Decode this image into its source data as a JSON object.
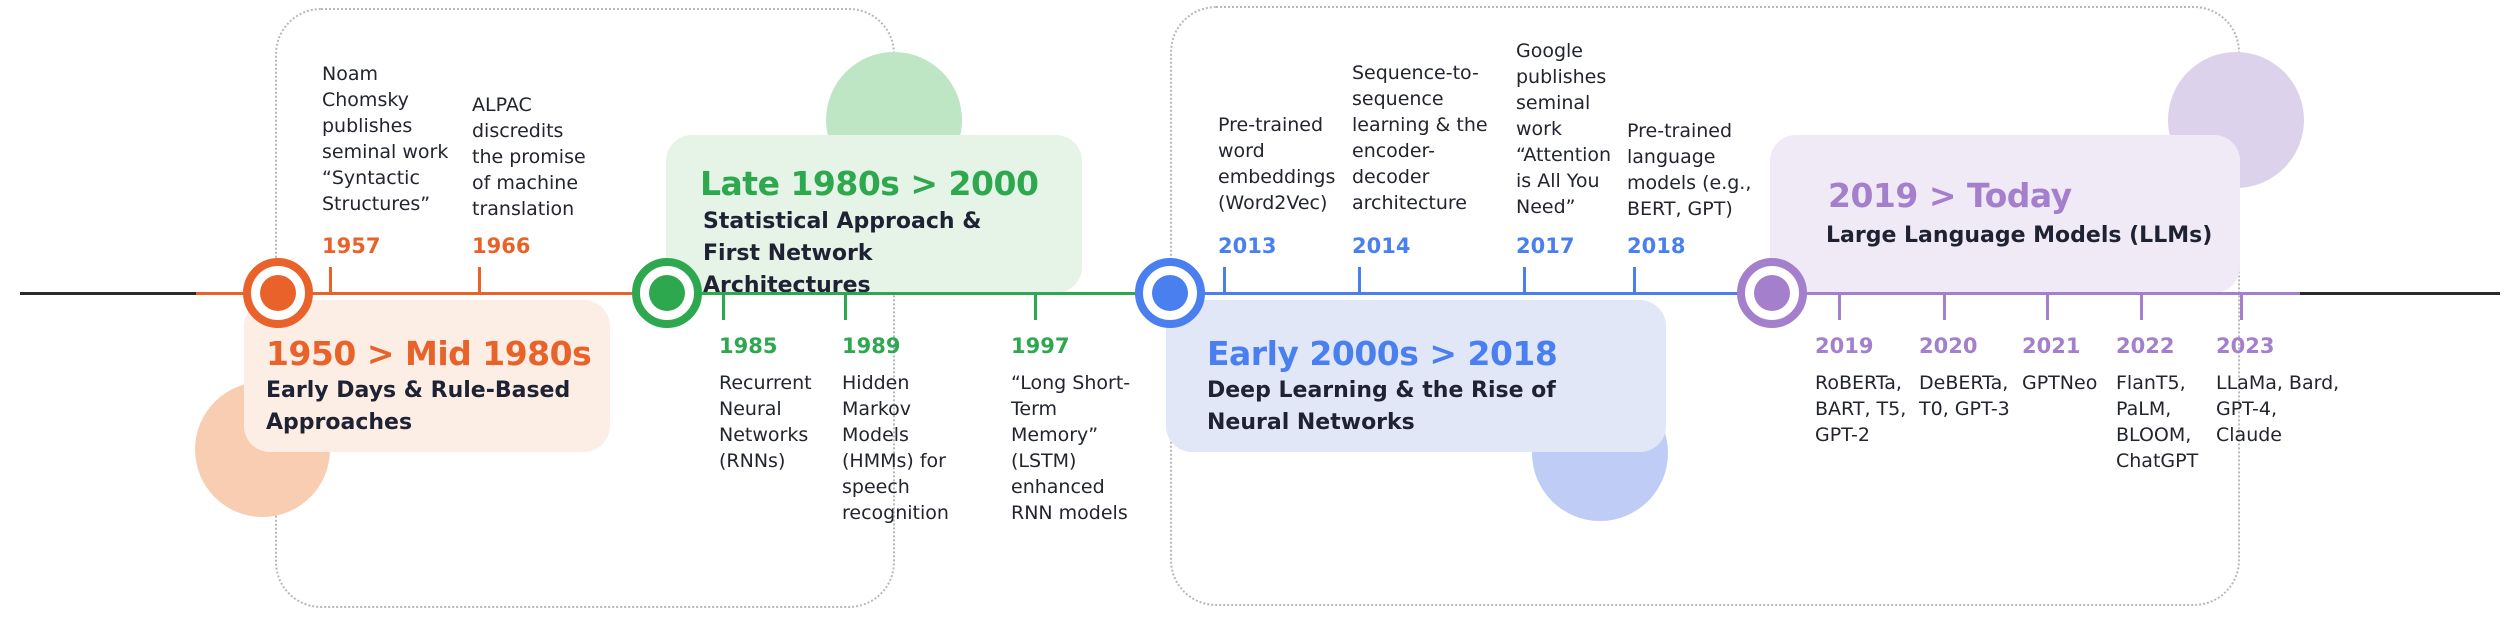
{
  "colors": {
    "orange": "#e8622a",
    "green": "#2ea84f",
    "blue": "#4a7ff0",
    "purple": "#a47fcc",
    "axis_dark": "#2a2a2a"
  },
  "eras": [
    {
      "title": "1950 > Mid 1980s",
      "subtitle": "Early Days & Rule-Based Approaches"
    },
    {
      "title": "Late 1980s > 2000",
      "subtitle": "Statistical Approach & First Network Architectures"
    },
    {
      "title": "Early 2000s > 2018",
      "subtitle": "Deep Learning & the Rise of Neural Networks"
    },
    {
      "title": "2019 > Today",
      "subtitle": "Large Language Models (LLMs)"
    }
  ],
  "events": [
    {
      "year": "1957",
      "text": "Noam Chomsky publishes seminal work “Syntactic Structures”"
    },
    {
      "year": "1966",
      "text": "ALPAC discredits the promise of machine translation"
    },
    {
      "year": "1985",
      "text": "Recurrent Neural Networks (RNNs)"
    },
    {
      "year": "1989",
      "text": "Hidden Markov Models (HMMs) for speech recognition"
    },
    {
      "year": "1997",
      "text": "“Long Short-Term Memory” (LSTM) enhanced RNN models"
    },
    {
      "year": "2013",
      "text": "Pre-trained word embeddings (Word2Vec)"
    },
    {
      "year": "2014",
      "text": "Sequence-to-sequence learning & the encoder-decoder architecture"
    },
    {
      "year": "2017",
      "text": "Google publishes seminal work “Attention is All You Need”"
    },
    {
      "year": "2018",
      "text": "Pre-trained language models (e.g., BERT, GPT)"
    },
    {
      "year": "2019",
      "text": "RoBERTa, BART, T5, GPT-2"
    },
    {
      "year": "2020",
      "text": "DeBERTa, T0, GPT-3"
    },
    {
      "year": "2021",
      "text": "GPTNeo"
    },
    {
      "year": "2022",
      "text": "FlanT5, PaLM, BLOOM, ChatGPT"
    },
    {
      "year": "2023",
      "text": "LLaMa, Bard, GPT-4, Claude"
    }
  ]
}
